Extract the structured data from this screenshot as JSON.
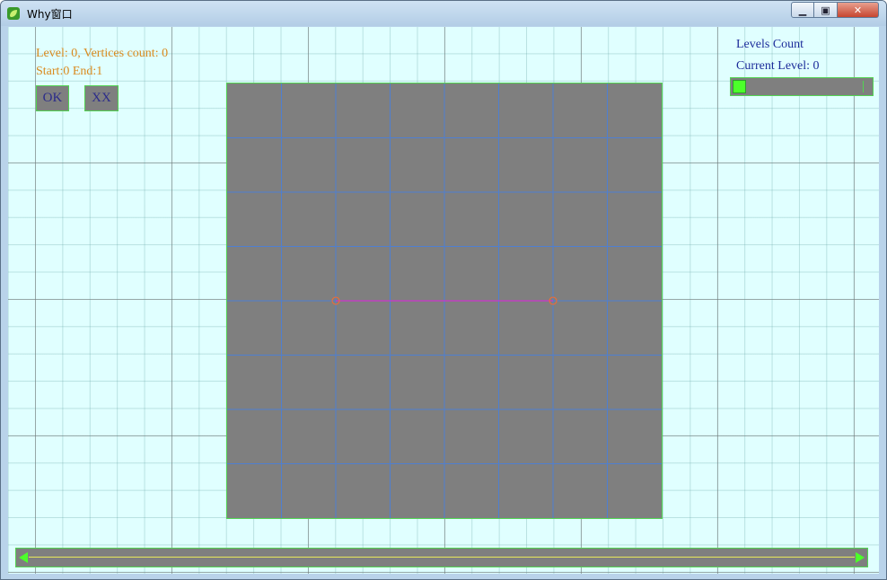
{
  "window": {
    "title": "Why窗口",
    "minimize_glyph": "▁",
    "maximize_glyph": "▣",
    "close_glyph": "✕"
  },
  "info": {
    "level_line": "Level: 0, Vertices count: 0",
    "start_end_line": "Start:0 End:1"
  },
  "buttons": {
    "ok_label": "OK",
    "xx_label": "XX"
  },
  "right_panel": {
    "levels_count_label": "Levels Count",
    "current_level_label": "Current Level: 0"
  },
  "level_slider": {
    "value": 0
  },
  "grid_panel": {
    "columns": 8,
    "rows": 8,
    "edge": {
      "start": {
        "col": 2,
        "row": 4
      },
      "end": {
        "col": 6,
        "row": 4
      }
    }
  },
  "colors": {
    "client_bg": "#e0ffff",
    "panel_fill": "#7f7f7f",
    "panel_border": "#52d352",
    "grid_line": "#4f7fd0",
    "edge_line": "#e020e0",
    "vertex": "#ff6a2a",
    "info_text": "#d98a1e",
    "label_text": "#1c2c9a",
    "accent_green": "#4cff2a"
  }
}
